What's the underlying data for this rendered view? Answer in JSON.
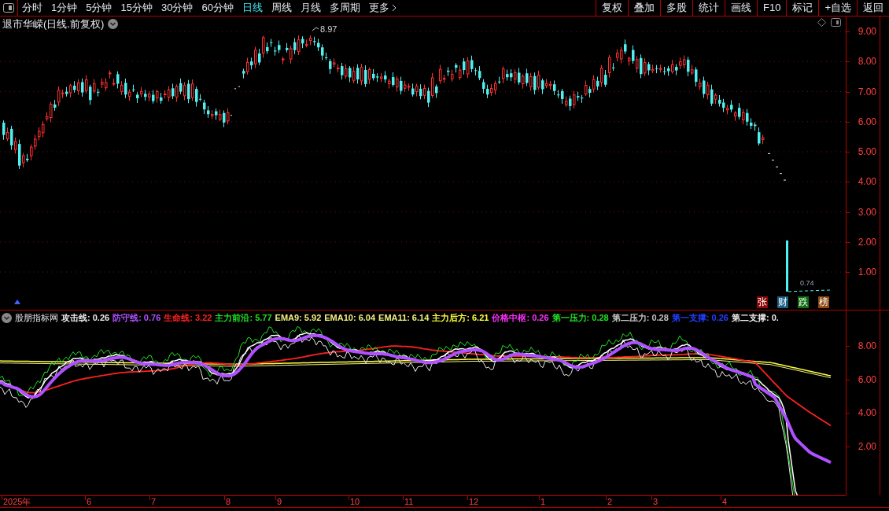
{
  "toolbar": {
    "periods": [
      {
        "label": "分时",
        "selected": false
      },
      {
        "label": "1分钟",
        "selected": false
      },
      {
        "label": "5分钟",
        "selected": false
      },
      {
        "label": "15分钟",
        "selected": false
      },
      {
        "label": "30分钟",
        "selected": false
      },
      {
        "label": "60分钟",
        "selected": false
      },
      {
        "label": "日线",
        "selected": true
      },
      {
        "label": "周线",
        "selected": false
      },
      {
        "label": "月线",
        "selected": false
      },
      {
        "label": "多周期",
        "selected": false
      }
    ],
    "more": "更多",
    "buttons": [
      "复权",
      "叠加",
      "多股",
      "统计",
      "画线",
      "F10",
      "标记",
      "+自选",
      "返回"
    ]
  },
  "chart": {
    "title": "退市华嵘(日线.前复权)",
    "high_label": "8.97",
    "volume_label": "0.74",
    "y_axis": [
      "9.00",
      "8.00",
      "7.00",
      "6.00",
      "5.00",
      "4.00",
      "3.00",
      "2.00",
      "1.00"
    ],
    "badges": [
      {
        "label": "张",
        "color": "#8b0a0a"
      },
      {
        "label": "财",
        "color": "#1a5f80"
      },
      {
        "label": "跌",
        "color": "#0d6e12"
      },
      {
        "label": "榜",
        "color": "#8a4a12"
      }
    ]
  },
  "indicator": {
    "name": "股朋指标网",
    "legend": [
      {
        "text": "攻击线: 0.26",
        "color": "#e8e8e8"
      },
      {
        "text": "防守线: 0.76",
        "color": "#b050ff"
      },
      {
        "text": "生命线: 3.22",
        "color": "#ff2020"
      },
      {
        "text": "主力前沿: 5.77",
        "color": "#20e020"
      },
      {
        "text": "EMA9: 5.92",
        "color": "#f0f080"
      },
      {
        "text": "EMA10: 6.04",
        "color": "#f0f081"
      },
      {
        "text": "EMA11: 6.14",
        "color": "#f0f082"
      },
      {
        "text": "主力后方: 6.21",
        "color": "#ffff40"
      },
      {
        "text": "价格中枢: 0.26",
        "color": "#ff30ff"
      },
      {
        "text": "第一压力: 0.28",
        "color": "#20e021"
      },
      {
        "text": "第二压力: 0.28",
        "color": "#c0c0c0"
      },
      {
        "text": "第一支撑: 0.26",
        "color": "#2040ff"
      },
      {
        "text": "第二支撑: 0.",
        "color": "#e8e8e9"
      }
    ],
    "y_axis": [
      "8.00",
      "6.00",
      "4.00",
      "2.00"
    ]
  },
  "x_axis": [
    "2025年",
    "6",
    "7",
    "8",
    "9",
    "10",
    "11",
    "12",
    "1",
    "2",
    "3",
    "4"
  ]
}
